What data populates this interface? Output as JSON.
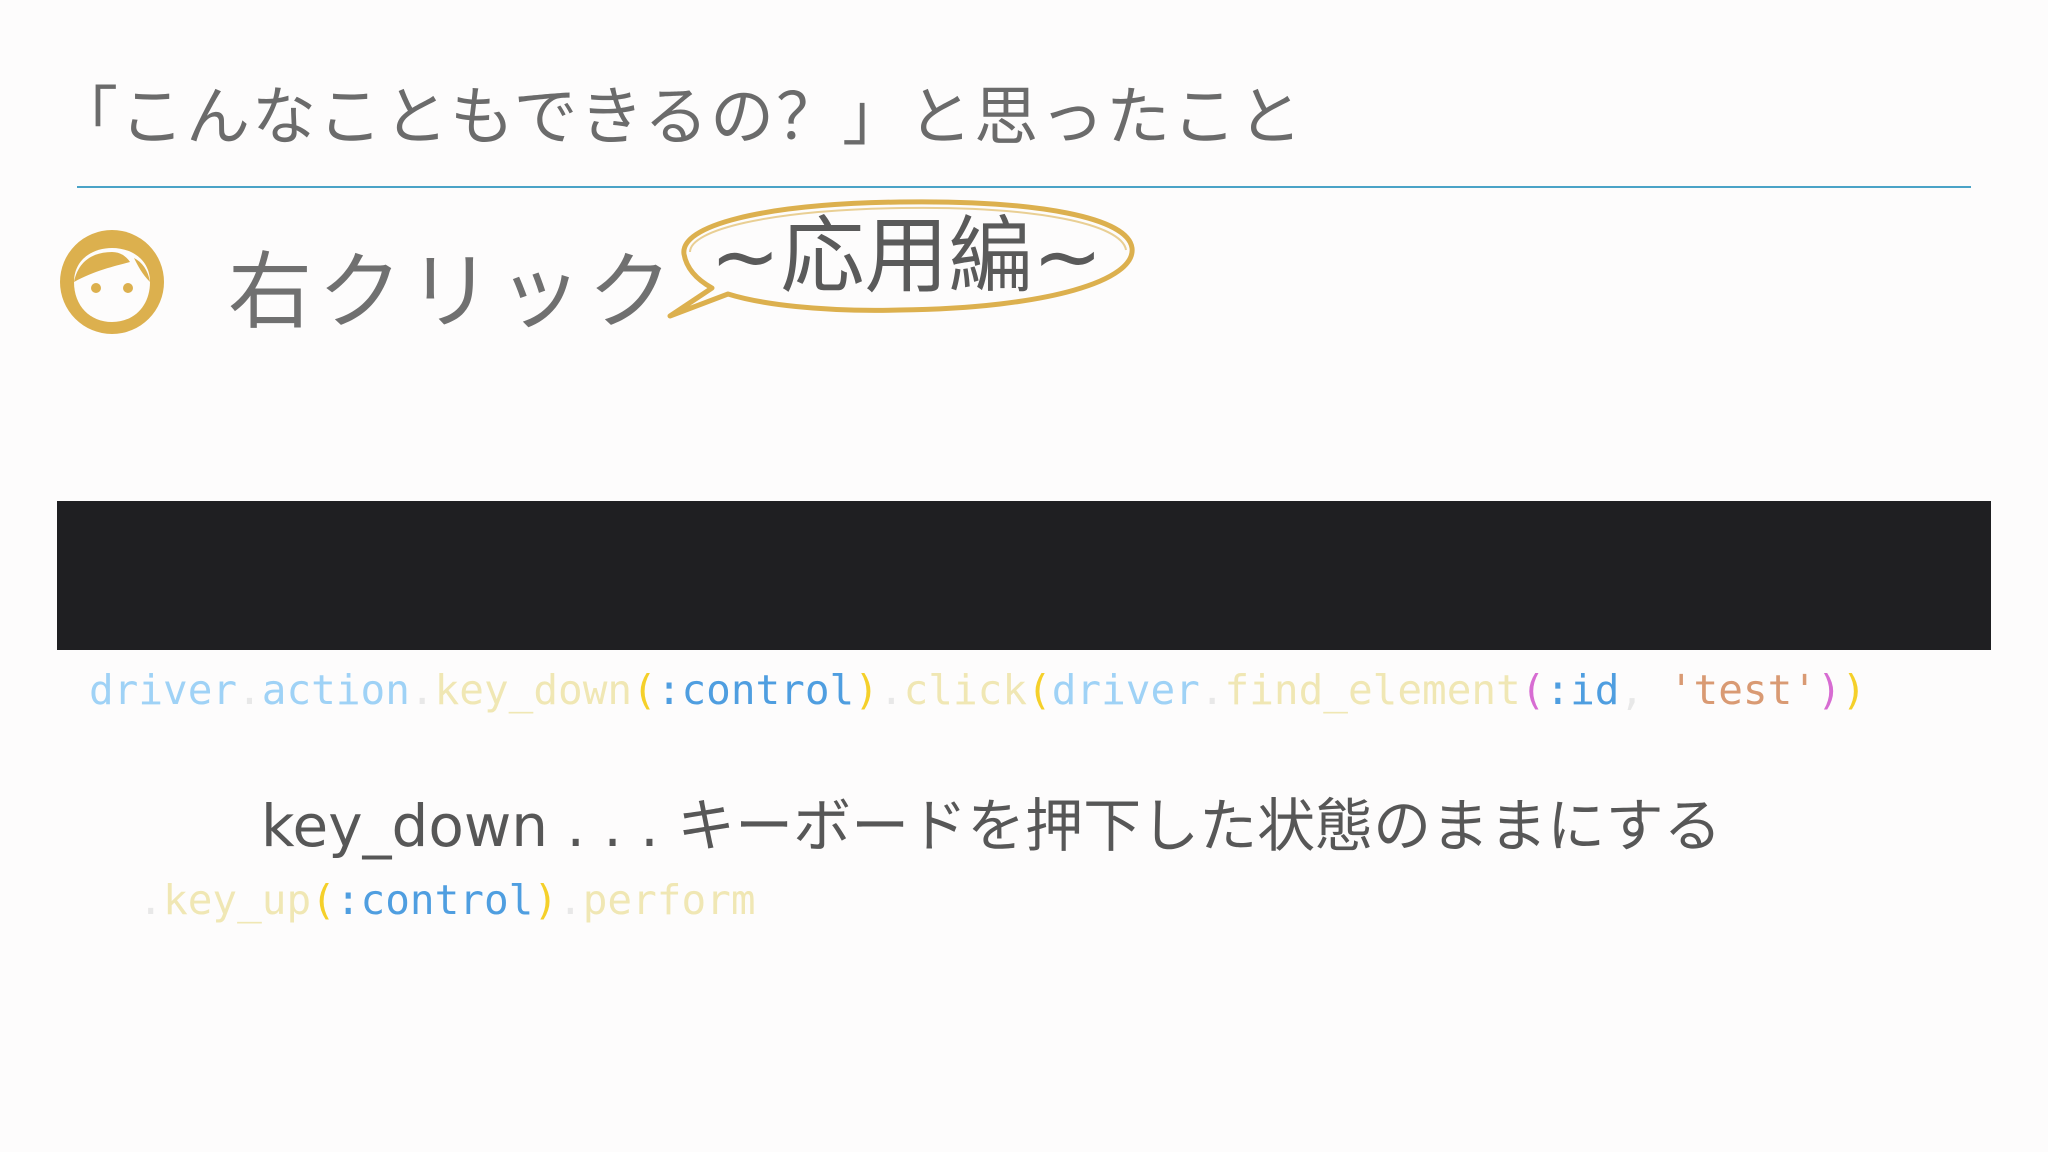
{
  "slide": {
    "title": "「こんなこともできるの？」と思ったこと",
    "heading": "右クリック",
    "bubble_label": "~応用編~",
    "face_icon": "face-icon",
    "colors": {
      "rule": "#4aa3c7",
      "face": "#dcb04e",
      "bubble_outline": "#dcb04e",
      "code_background": "#1f1f22"
    }
  },
  "code": {
    "line1": [
      {
        "text": "driver",
        "kind": "var"
      },
      {
        "text": ".",
        "kind": "punc"
      },
      {
        "text": "action",
        "kind": "var"
      },
      {
        "text": ".",
        "kind": "punc"
      },
      {
        "text": "key_down",
        "kind": "method"
      },
      {
        "text": "(",
        "kind": "paren"
      },
      {
        "text": ":control",
        "kind": "sym"
      },
      {
        "text": ")",
        "kind": "paren"
      },
      {
        "text": ".",
        "kind": "punc"
      },
      {
        "text": "click",
        "kind": "method"
      },
      {
        "text": "(",
        "kind": "paren"
      },
      {
        "text": "driver",
        "kind": "var"
      },
      {
        "text": ".",
        "kind": "punc"
      },
      {
        "text": "find_element",
        "kind": "method"
      },
      {
        "text": "(",
        "kind": "paren2"
      },
      {
        "text": ":id",
        "kind": "sym"
      },
      {
        "text": ", ",
        "kind": "plain"
      },
      {
        "text": "'test'",
        "kind": "str"
      },
      {
        "text": ")",
        "kind": "paren2"
      },
      {
        "text": ")",
        "kind": "paren"
      }
    ],
    "line2": [
      {
        "text": "  .",
        "kind": "punc"
      },
      {
        "text": "key_up",
        "kind": "method"
      },
      {
        "text": "(",
        "kind": "paren"
      },
      {
        "text": ":control",
        "kind": "sym"
      },
      {
        "text": ")",
        "kind": "paren"
      },
      {
        "text": ".",
        "kind": "punc"
      },
      {
        "text": "perform",
        "kind": "method"
      }
    ]
  },
  "explanation": "key_down . . . キーボードを押下した状態のままにする"
}
